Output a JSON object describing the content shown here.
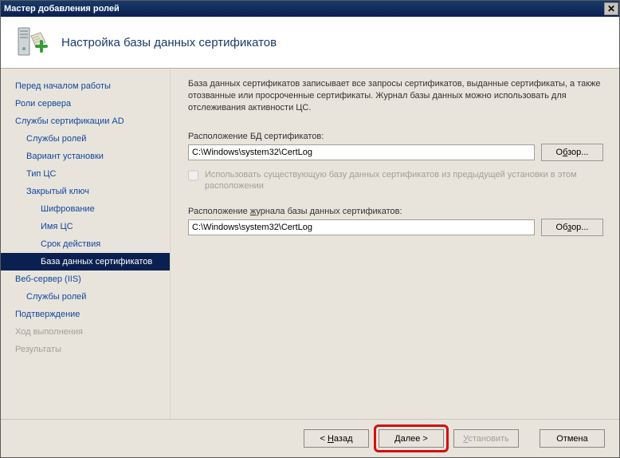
{
  "window": {
    "title": "Мастер добавления ролей"
  },
  "header": {
    "title": "Настройка базы данных сертификатов"
  },
  "sidebar": {
    "items": [
      {
        "label": "Перед началом работы",
        "level": 0,
        "state": "normal"
      },
      {
        "label": "Роли сервера",
        "level": 0,
        "state": "normal"
      },
      {
        "label": "Службы сертификации AD",
        "level": 0,
        "state": "normal"
      },
      {
        "label": "Службы ролей",
        "level": 1,
        "state": "normal"
      },
      {
        "label": "Вариант установки",
        "level": 1,
        "state": "normal"
      },
      {
        "label": "Тип ЦС",
        "level": 1,
        "state": "normal"
      },
      {
        "label": "Закрытый ключ",
        "level": 1,
        "state": "normal"
      },
      {
        "label": "Шифрование",
        "level": 2,
        "state": "normal"
      },
      {
        "label": "Имя ЦС",
        "level": 2,
        "state": "normal"
      },
      {
        "label": "Срок действия",
        "level": 2,
        "state": "normal"
      },
      {
        "label": "База данных сертификатов",
        "level": 2,
        "state": "selected"
      },
      {
        "label": "Веб-сервер (IIS)",
        "level": 0,
        "state": "normal"
      },
      {
        "label": "Службы ролей",
        "level": 1,
        "state": "normal"
      },
      {
        "label": "Подтверждение",
        "level": 0,
        "state": "normal"
      },
      {
        "label": "Ход выполнения",
        "level": 0,
        "state": "disabled"
      },
      {
        "label": "Результаты",
        "level": 0,
        "state": "disabled"
      }
    ]
  },
  "content": {
    "description": "База данных сертификатов записывает все запросы сертификатов, выданные сертификаты, а также отозванные или просроченные сертификаты. Журнал базы данных можно использовать для отслеживания активности ЦС.",
    "db_location_label": "Расположение БД сертификатов:",
    "db_location_value": "C:\\Windows\\system32\\CertLog",
    "reuse_label": "Использовать существующую базу данных сертификатов из предыдущей установки в этом расположении",
    "log_location_label_pre": "Расположение ",
    "log_location_label_u": "ж",
    "log_location_label_post": "урнала базы данных сертификатов:",
    "log_location_value": "C:\\Windows\\system32\\CertLog",
    "browse_pre": "О",
    "browse_u": "б",
    "browse_post": "зор...",
    "browse2_pre": "Об",
    "browse2_u": "з",
    "browse2_post": "ор..."
  },
  "footer": {
    "back_pre": "< ",
    "back_u": "Н",
    "back_post": "азад",
    "next_pre": "",
    "next_u": "Д",
    "next_post": "алее >",
    "install_pre": "",
    "install_u": "У",
    "install_post": "становить",
    "cancel": "Отмена"
  }
}
